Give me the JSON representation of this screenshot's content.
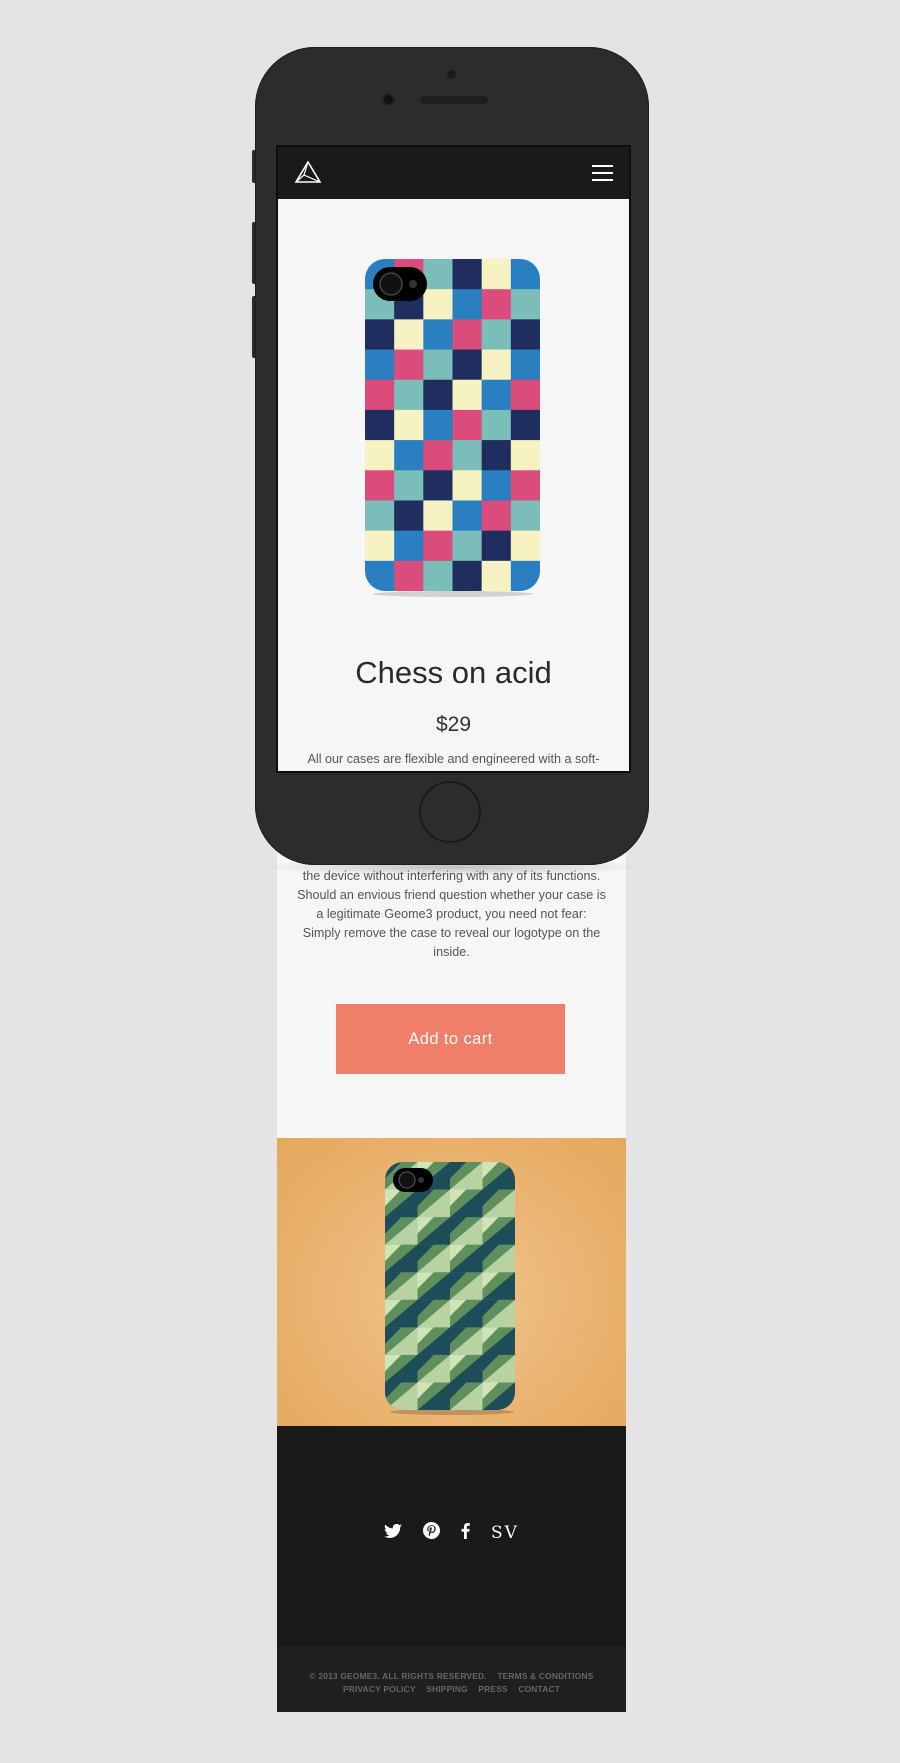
{
  "product": {
    "title": "Chess on acid",
    "price": "$29",
    "description_lines": [
      "All our cases are flexible and engineered with a soft-",
      "the device without interfering with any of its functions.",
      "Should an envious friend question whether your case is",
      "a legitimate Geome3 product, you need not fear:",
      "Simply remove the case to reveal our logotype on the",
      "inside."
    ],
    "add_to_cart_label": "Add to cart"
  },
  "social": {
    "twitter": "twitter-icon",
    "pinterest": "pinterest-icon",
    "facebook": "facebook-icon",
    "sv_label": "SV"
  },
  "footer": {
    "copyright": "© 2013 GEOME3. ALL RIGHTS RESERVED.",
    "links": [
      "TERMS & CONDITIONS",
      "PRIVACY POLICY",
      "SHIPPING",
      "PRESS",
      "CONTACT"
    ]
  },
  "colors": {
    "accent": "#f07f6a",
    "phone_body": "#2b2c2b",
    "navbar": "#1a1a1a",
    "case1_palette": [
      "#2a7fc1",
      "#1f2e5e",
      "#d94c7c",
      "#f7f2c2",
      "#7bbdb8"
    ],
    "case2_palette": [
      "#5f8f5c",
      "#1e4d5a",
      "#b8d2a3",
      "#cfe5b7"
    ]
  }
}
